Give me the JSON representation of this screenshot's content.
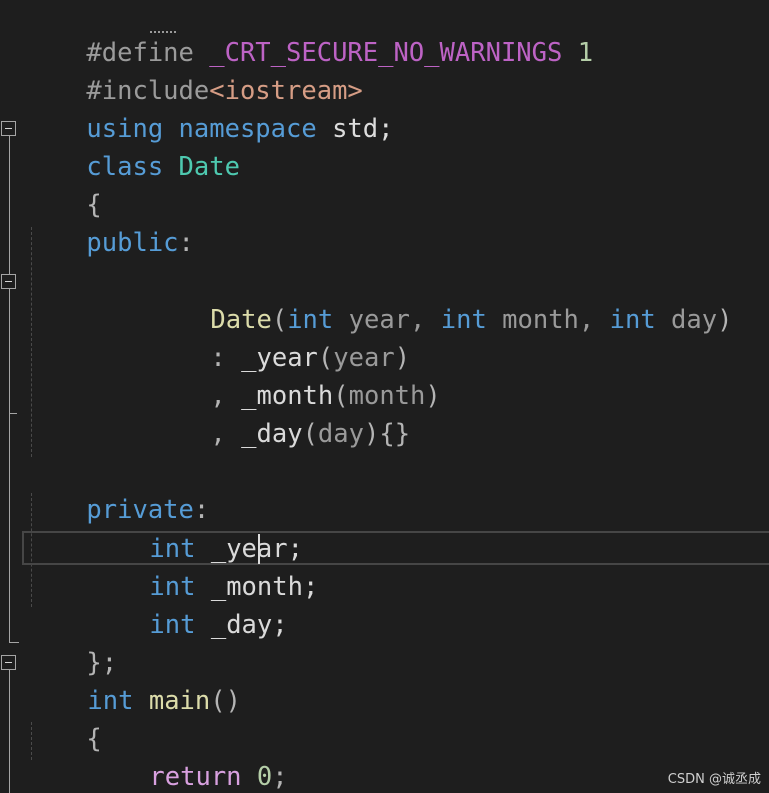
{
  "code": {
    "l1": {
      "a": "#define ",
      "b": "_CRT_SECURE_NO_WARNINGS",
      "c": " 1"
    },
    "l2": {
      "a": "#include",
      "b": "<iostream>"
    },
    "l3": {
      "a": "using",
      "b": " ",
      "c": "namespace",
      "d": " std;"
    },
    "l4": {
      "a": "class",
      "b": " ",
      "c": "Date"
    },
    "l5": {
      "a": "{"
    },
    "l6": {
      "a": "public",
      "b": ":"
    },
    "l8": {
      "a": "Date",
      "b": "(",
      "c": "int",
      "d": " year, ",
      "e": "int",
      "f": " month, ",
      "g": "int",
      "h": " day",
      "i": ")"
    },
    "l9": {
      "a": ": ",
      "b": "_year",
      "c": "(",
      "d": "year",
      "e": ")"
    },
    "l10": {
      "a": ", ",
      "b": "_month",
      "c": "(",
      "d": "month",
      "e": ")"
    },
    "l11": {
      "a": ", ",
      "b": "_day",
      "c": "(",
      "d": "day",
      "e": "){}"
    },
    "l13": {
      "a": "private",
      "b": ":"
    },
    "l14": {
      "a": "int",
      "b": " _year;"
    },
    "l15": {
      "a": "int",
      "b": " _month;"
    },
    "l16": {
      "a": "int",
      "b": " _day;"
    },
    "l17": {
      "a": "};"
    },
    "l18": {
      "a": "int",
      "b": " ",
      "c": "main",
      "d": "()"
    },
    "l19": {
      "a": "{"
    },
    "l20": {
      "a": "return",
      "b": " ",
      "c": "0",
      "d": ";"
    },
    "l21": {
      "a": "}"
    }
  },
  "watermark": "CSDN @诚丞成",
  "colors": {
    "background": "#1e1e1e",
    "keyword": "#569cd6",
    "type": "#4ec9b0",
    "function": "#dcdcaa",
    "string": "#d69d85",
    "number": "#b5cea8",
    "control": "#d8a0df",
    "macro": "#bd63c5"
  }
}
